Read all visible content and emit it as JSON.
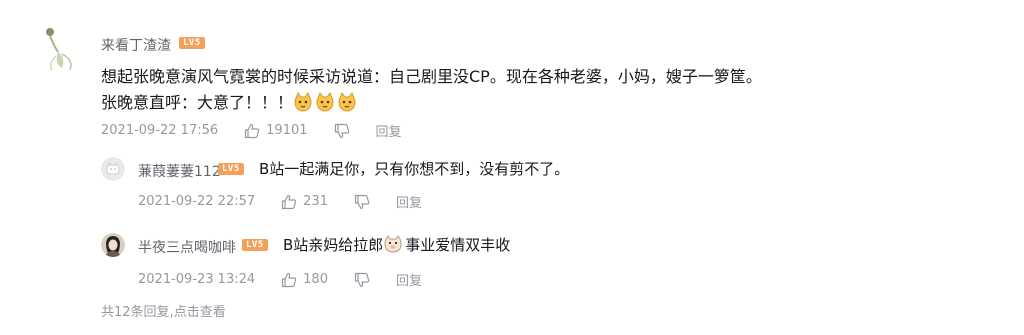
{
  "main_comment": {
    "username": "来看丁渣渣",
    "level": "LV5",
    "line1": "想起张晚意演风气霓裳的时候采访说道：自己剧里没CP。现在各种老婆，小妈，嫂子一箩筐。",
    "line2": "张晚意直呼：大意了！！！",
    "time": "2021-09-22 17:56",
    "likes": "19101",
    "reply_label": "回复"
  },
  "replies": [
    {
      "username": "蒹葭萋萋112",
      "level": "LV5",
      "content": "B站一起满足你，只有你想不到，没有剪不了。",
      "time": "2021-09-22 22:57",
      "likes": "231",
      "reply_label": "回复"
    },
    {
      "username": "半夜三点喝咖啡",
      "level": "LV5",
      "content_before": "B站亲妈给拉郎",
      "content_after": "事业爱情双丰收",
      "time": "2021-09-23 13:24",
      "likes": "180",
      "reply_label": "回复"
    }
  ],
  "footer": {
    "count_text": "共12条回复,",
    "more_link": "点击查看"
  },
  "icons": {
    "like": "thumb-up-icon",
    "dislike": "thumb-down-icon",
    "emoji": "cat-face-emoji"
  },
  "colors": {
    "level_badge": "#f5a05a",
    "meta_text": "#9499a0",
    "content_text": "#18191c"
  }
}
